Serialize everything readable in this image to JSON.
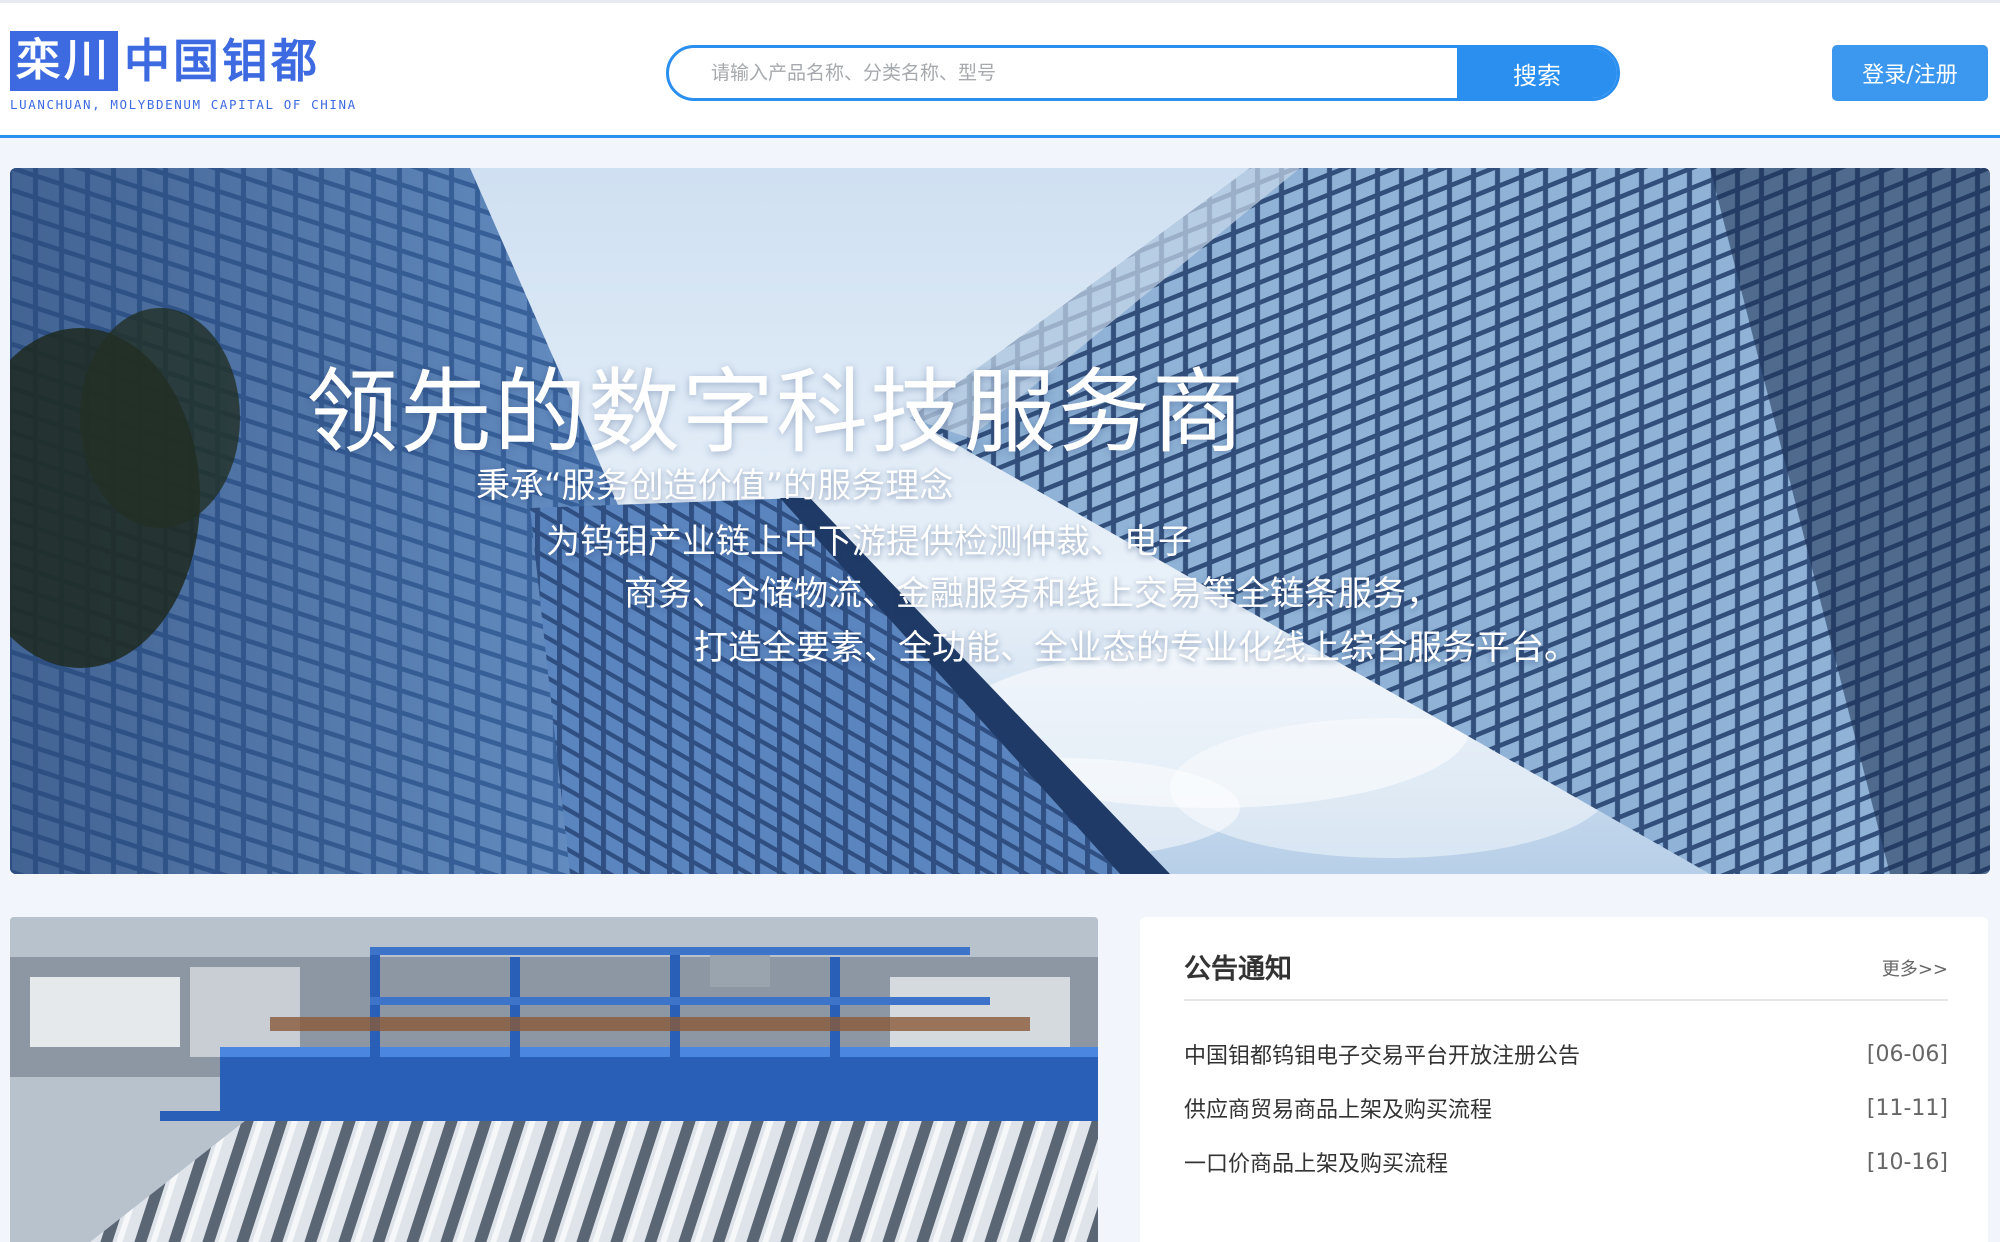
{
  "header": {
    "logo_mark": "栾川",
    "logo_name": "中国钼都",
    "logo_sub": "LUANCHUAN, MOLYBDENUM CAPITAL OF CHINA",
    "search_placeholder": "请输入产品名称、分类名称、型号",
    "search_button": "搜索",
    "login_button": "登录/注册"
  },
  "banner": {
    "title": "领先的数字科技服务商",
    "lines": [
      "秉承“服务创造价值”的服务理念",
      "为钨钼产业链上中下游提供检测仲裁、电子",
      "商务、仓储物流、金融服务和线上交易等全链条服务，",
      "打造全要素、全功能、全业态的专业化线上综合服务平台。"
    ]
  },
  "notice": {
    "title": "公告通知",
    "more": "更多>>",
    "items": [
      {
        "title": "中国钼都钨钼电子交易平台开放注册公告",
        "date": "[06-06]"
      },
      {
        "title": "供应商贸易商品上架及购买流程",
        "date": "[11-11]"
      },
      {
        "title": "一口价商品上架及购买流程",
        "date": "[10-16]"
      }
    ]
  },
  "colors": {
    "accent": "#2b8ff0",
    "logo_blue": "#3d6ae0",
    "login_bg": "#3c97ee",
    "page_bg": "#f2f6fc"
  }
}
